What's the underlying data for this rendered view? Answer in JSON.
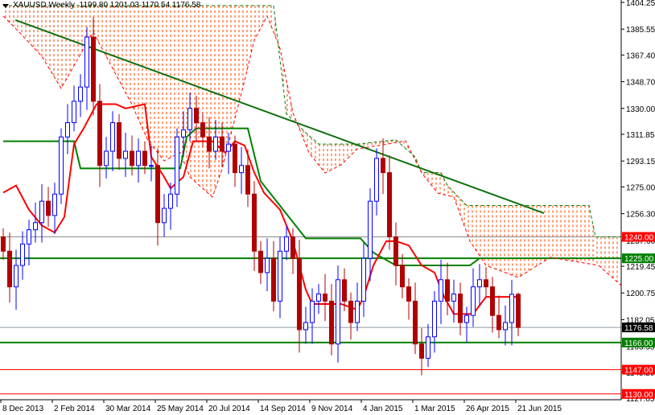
{
  "header": {
    "symbol": "XAUUSD,Weekly",
    "ohlc": "1199.80 1201.03 1170.54 1176.58"
  },
  "chart_data": {
    "type": "candlestick",
    "title": "XAUUSD,Weekly",
    "timeframe": "Weekly",
    "ylim": [
      1127.05,
      1404.25
    ],
    "y_ticks": [
      "1404.25",
      "1385.55",
      "1367.40",
      "1348.70",
      "1330.00",
      "1311.85",
      "1293.15",
      "1275.00",
      "1256.30",
      "1237.60",
      "1219.45",
      "1200.75",
      "1182.05",
      "1163.35",
      "1145.20",
      "1127.05"
    ],
    "x_ticks": [
      {
        "index": 0,
        "label": "8 Dec 2013"
      },
      {
        "index": 8,
        "label": "2 Feb 2014"
      },
      {
        "index": 16,
        "label": "30 Mar 2014"
      },
      {
        "index": 24,
        "label": "25 May 2014"
      },
      {
        "index": 32,
        "label": "20 Jul 2014"
      },
      {
        "index": 40,
        "label": "14 Sep 2014"
      },
      {
        "index": 48,
        "label": "9 Nov 2014"
      },
      {
        "index": 56,
        "label": "4 Jan 2015"
      },
      {
        "index": 64,
        "label": "1 Mar 2015"
      },
      {
        "index": 72,
        "label": "26 Apr 2015"
      },
      {
        "index": 80,
        "label": "21 Jun 2015"
      }
    ],
    "first_open": 1240,
    "closes": [
      1230,
      1205,
      1220,
      1235,
      1245,
      1250,
      1265,
      1255,
      1270,
      1310,
      1320,
      1335,
      1345,
      1380,
      1335,
      1290,
      1300,
      1320,
      1295,
      1300,
      1290,
      1300,
      1290,
      1290,
      1250,
      1260,
      1270,
      1310,
      1315,
      1330,
      1320,
      1310,
      1300,
      1310,
      1300,
      1305,
      1285,
      1290,
      1270,
      1230,
      1215,
      1225,
      1195,
      1230,
      1240,
      1225,
      1175,
      1180,
      1195,
      1200,
      1195,
      1165,
      1210,
      1195,
      1180,
      1195,
      1225,
      1265,
      1295,
      1285,
      1240,
      1220,
      1205,
      1195,
      1165,
      1155,
      1170,
      1195,
      1210,
      1195,
      1200,
      1180,
      1185,
      1205,
      1210,
      1205,
      1185,
      1175,
      1180,
      1199.8,
      1176.58
    ],
    "last_candle": {
      "open": 1199.8,
      "high": 1201.03,
      "low": 1170.54,
      "close": 1176.58
    },
    "cloud_upper": [
      [
        0,
        1402
      ],
      [
        42,
        1402
      ],
      [
        44,
        1326
      ],
      [
        47,
        1313
      ],
      [
        49,
        1305
      ],
      [
        55,
        1305
      ],
      [
        61,
        1308
      ],
      [
        64,
        1296
      ],
      [
        65,
        1285
      ],
      [
        68,
        1285
      ],
      [
        69,
        1276
      ],
      [
        72,
        1262
      ],
      [
        91,
        1262
      ],
      [
        92,
        1240
      ],
      [
        96,
        1240
      ]
    ],
    "cloud_lower": [
      [
        0,
        1394.7
      ],
      [
        2.5,
        1383.4
      ],
      [
        6,
        1366.5
      ],
      [
        9,
        1344
      ],
      [
        12.5,
        1372
      ],
      [
        14,
        1383.4
      ],
      [
        16,
        1366.5
      ],
      [
        20,
        1332.7
      ],
      [
        22.5,
        1307.3
      ],
      [
        25,
        1293.3
      ],
      [
        27.5,
        1298.9
      ],
      [
        29,
        1282
      ],
      [
        32.5,
        1267.9
      ],
      [
        34,
        1287.6
      ],
      [
        37.5,
        1349.6
      ],
      [
        39,
        1377.8
      ],
      [
        41,
        1394.7
      ],
      [
        43,
        1372
      ],
      [
        45,
        1327
      ],
      [
        47.5,
        1298.9
      ],
      [
        50,
        1284.8
      ],
      [
        52.5,
        1290.5
      ],
      [
        55,
        1301.7
      ],
      [
        59,
        1304.5
      ],
      [
        62.5,
        1307.3
      ],
      [
        65,
        1284.8
      ],
      [
        67.5,
        1270.7
      ],
      [
        70,
        1267.9
      ],
      [
        72.5,
        1237
      ],
      [
        75,
        1220
      ],
      [
        80,
        1211.6
      ],
      [
        85,
        1225.7
      ],
      [
        92.5,
        1220
      ],
      [
        96,
        1206
      ]
    ],
    "kijun": [
      [
        0,
        1307
      ],
      [
        11,
        1307
      ],
      [
        12,
        1288
      ],
      [
        27.5,
        1288
      ],
      [
        28.5,
        1310
      ],
      [
        30,
        1316
      ],
      [
        38,
        1316
      ],
      [
        40,
        1279
      ],
      [
        43.5,
        1259
      ],
      [
        47,
        1239
      ],
      [
        55.5,
        1239
      ],
      [
        57.5,
        1229
      ],
      [
        61,
        1220
      ],
      [
        72.5,
        1220
      ],
      [
        74,
        1225
      ]
    ],
    "tenkan": [
      [
        0,
        1271
      ],
      [
        2,
        1276
      ],
      [
        4,
        1259
      ],
      [
        6,
        1248
      ],
      [
        8,
        1243
      ],
      [
        9.5,
        1254
      ],
      [
        11,
        1305
      ],
      [
        12.5,
        1316
      ],
      [
        14.5,
        1333
      ],
      [
        17.5,
        1333
      ],
      [
        19,
        1330
      ],
      [
        22,
        1333
      ],
      [
        23,
        1296
      ],
      [
        25,
        1282
      ],
      [
        26,
        1274
      ],
      [
        28,
        1282
      ],
      [
        29.5,
        1307
      ],
      [
        32.5,
        1307
      ],
      [
        34.5,
        1299
      ],
      [
        36,
        1307
      ],
      [
        37.5,
        1304
      ],
      [
        39,
        1285
      ],
      [
        40.5,
        1271
      ],
      [
        43,
        1259
      ],
      [
        45,
        1237
      ],
      [
        47,
        1203
      ],
      [
        48,
        1193
      ],
      [
        52.5,
        1193
      ],
      [
        55,
        1189
      ],
      [
        56,
        1198
      ],
      [
        57.5,
        1220
      ],
      [
        59.5,
        1237
      ],
      [
        61,
        1237
      ],
      [
        63,
        1234
      ],
      [
        65,
        1220
      ],
      [
        67,
        1215
      ],
      [
        68.5,
        1198
      ],
      [
        70,
        1186
      ],
      [
        73,
        1186
      ],
      [
        75,
        1198
      ],
      [
        80,
        1198
      ]
    ],
    "trendline": [
      [
        1.9,
        1391.9
      ],
      [
        84,
        1256.6
      ]
    ],
    "levels": [
      {
        "price": 1240.0,
        "label": "1240.00",
        "color": "#ff0000",
        "line": "#8c8c8c"
      },
      {
        "price": 1225.0,
        "label": "1225.00",
        "color": "#008000",
        "line": "#008000"
      },
      {
        "price": 1176.58,
        "label": "1176.58",
        "color": "#000000",
        "line": "#8c9aa8"
      },
      {
        "price": 1166.0,
        "label": "1166.00",
        "color": "#008000",
        "line": "#008000"
      },
      {
        "price": 1147.0,
        "label": "1147.00",
        "color": "#ff0000",
        "line": "#ff0000"
      },
      {
        "price": 1130.0,
        "label": "1130.00",
        "color": "#ff0000",
        "line": "#ff0000"
      }
    ],
    "colors": {
      "bull": "#0000ff",
      "bear": "#b00000",
      "tenkan": "#ff0000",
      "kijun": "#008000",
      "cloud": "#ff6020",
      "trend": "#107010"
    }
  }
}
